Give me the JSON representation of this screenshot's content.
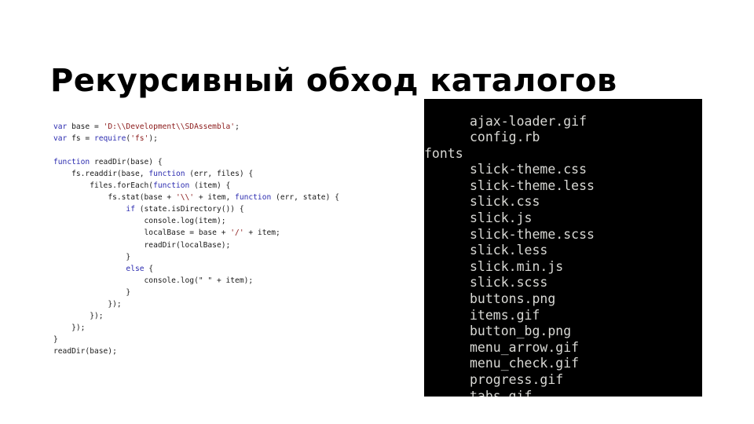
{
  "slide": {
    "title": "Рекурсивный обход каталогов",
    "background_color": "#ffffff",
    "text_color": "#000000"
  },
  "code": {
    "language": "javascript",
    "colors": {
      "keyword": "#2c2cb0",
      "string": "#8b1a1a",
      "plain": "#1a1a1a",
      "background": "#ffffff"
    },
    "lines": [
      {
        "indent": 0,
        "tokens": [
          {
            "t": "kw",
            "v": "var"
          },
          {
            "t": "pln",
            "v": " base = "
          },
          {
            "t": "str",
            "v": "'D:\\\\Development\\\\SDAssembla'"
          },
          {
            "t": "pln",
            "v": ";"
          }
        ]
      },
      {
        "indent": 0,
        "tokens": [
          {
            "t": "kw",
            "v": "var"
          },
          {
            "t": "pln",
            "v": " fs = "
          },
          {
            "t": "kw",
            "v": "require"
          },
          {
            "t": "pln",
            "v": "("
          },
          {
            "t": "str",
            "v": "'fs'"
          },
          {
            "t": "pln",
            "v": ");"
          }
        ]
      },
      {
        "indent": 0,
        "tokens": []
      },
      {
        "indent": 0,
        "tokens": [
          {
            "t": "kw",
            "v": "function"
          },
          {
            "t": "pln",
            "v": " readDir(base) {"
          }
        ]
      },
      {
        "indent": 4,
        "tokens": [
          {
            "t": "pln",
            "v": "fs.readdir(base, "
          },
          {
            "t": "kw",
            "v": "function"
          },
          {
            "t": "pln",
            "v": " (err, files) {"
          }
        ]
      },
      {
        "indent": 8,
        "tokens": [
          {
            "t": "pln",
            "v": "files.forEach("
          },
          {
            "t": "kw",
            "v": "function"
          },
          {
            "t": "pln",
            "v": " (item) {"
          }
        ]
      },
      {
        "indent": 12,
        "tokens": [
          {
            "t": "pln",
            "v": "fs.stat(base + "
          },
          {
            "t": "str",
            "v": "'\\\\'"
          },
          {
            "t": "pln",
            "v": " + item, "
          },
          {
            "t": "kw",
            "v": "function"
          },
          {
            "t": "pln",
            "v": " (err, state) {"
          }
        ]
      },
      {
        "indent": 16,
        "tokens": [
          {
            "t": "kw",
            "v": "if"
          },
          {
            "t": "pln",
            "v": " (state.isDirectory()) {"
          }
        ]
      },
      {
        "indent": 20,
        "tokens": [
          {
            "t": "pln",
            "v": "console.log(item);"
          }
        ]
      },
      {
        "indent": 20,
        "tokens": [
          {
            "t": "pln",
            "v": "localBase = base + "
          },
          {
            "t": "str",
            "v": "'/'"
          },
          {
            "t": "pln",
            "v": " + item;"
          }
        ]
      },
      {
        "indent": 20,
        "tokens": [
          {
            "t": "pln",
            "v": "readDir(localBase);"
          }
        ]
      },
      {
        "indent": 16,
        "tokens": [
          {
            "t": "pln",
            "v": "}"
          }
        ]
      },
      {
        "indent": 16,
        "tokens": [
          {
            "t": "kw",
            "v": "else"
          },
          {
            "t": "pln",
            "v": " {"
          }
        ]
      },
      {
        "indent": 20,
        "tokens": [
          {
            "t": "pln",
            "v": "console.log(\" \" + item);"
          }
        ]
      },
      {
        "indent": 16,
        "tokens": [
          {
            "t": "pln",
            "v": "}"
          }
        ]
      },
      {
        "indent": 12,
        "tokens": [
          {
            "t": "pln",
            "v": "});"
          }
        ]
      },
      {
        "indent": 8,
        "tokens": [
          {
            "t": "pln",
            "v": "});"
          }
        ]
      },
      {
        "indent": 4,
        "tokens": [
          {
            "t": "pln",
            "v": "});"
          }
        ]
      },
      {
        "indent": 0,
        "tokens": [
          {
            "t": "pln",
            "v": "}"
          }
        ]
      },
      {
        "indent": 0,
        "tokens": [
          {
            "t": "pln",
            "v": "readDir(base);"
          }
        ]
      }
    ]
  },
  "terminal": {
    "background_color": "#000000",
    "text_color": "#d8d8d4",
    "lines": [
      {
        "kind": "file",
        "text": "ajax-loader.gif"
      },
      {
        "kind": "file",
        "text": "config.rb"
      },
      {
        "kind": "dir",
        "text": "fonts"
      },
      {
        "kind": "file",
        "text": "slick-theme.css"
      },
      {
        "kind": "file",
        "text": "slick-theme.less"
      },
      {
        "kind": "file",
        "text": "slick.css"
      },
      {
        "kind": "file",
        "text": "slick.js"
      },
      {
        "kind": "file",
        "text": "slick-theme.scss"
      },
      {
        "kind": "file",
        "text": "slick.less"
      },
      {
        "kind": "file",
        "text": "slick.min.js"
      },
      {
        "kind": "file",
        "text": "slick.scss"
      },
      {
        "kind": "file",
        "text": "buttons.png"
      },
      {
        "kind": "file",
        "text": "items.gif"
      },
      {
        "kind": "file",
        "text": "button_bg.png"
      },
      {
        "kind": "file",
        "text": "menu_arrow.gif"
      },
      {
        "kind": "file",
        "text": "menu_check.gif"
      },
      {
        "kind": "file",
        "text": "progress.gif"
      },
      {
        "kind": "file",
        "text": "tabs.gif"
      }
    ]
  }
}
